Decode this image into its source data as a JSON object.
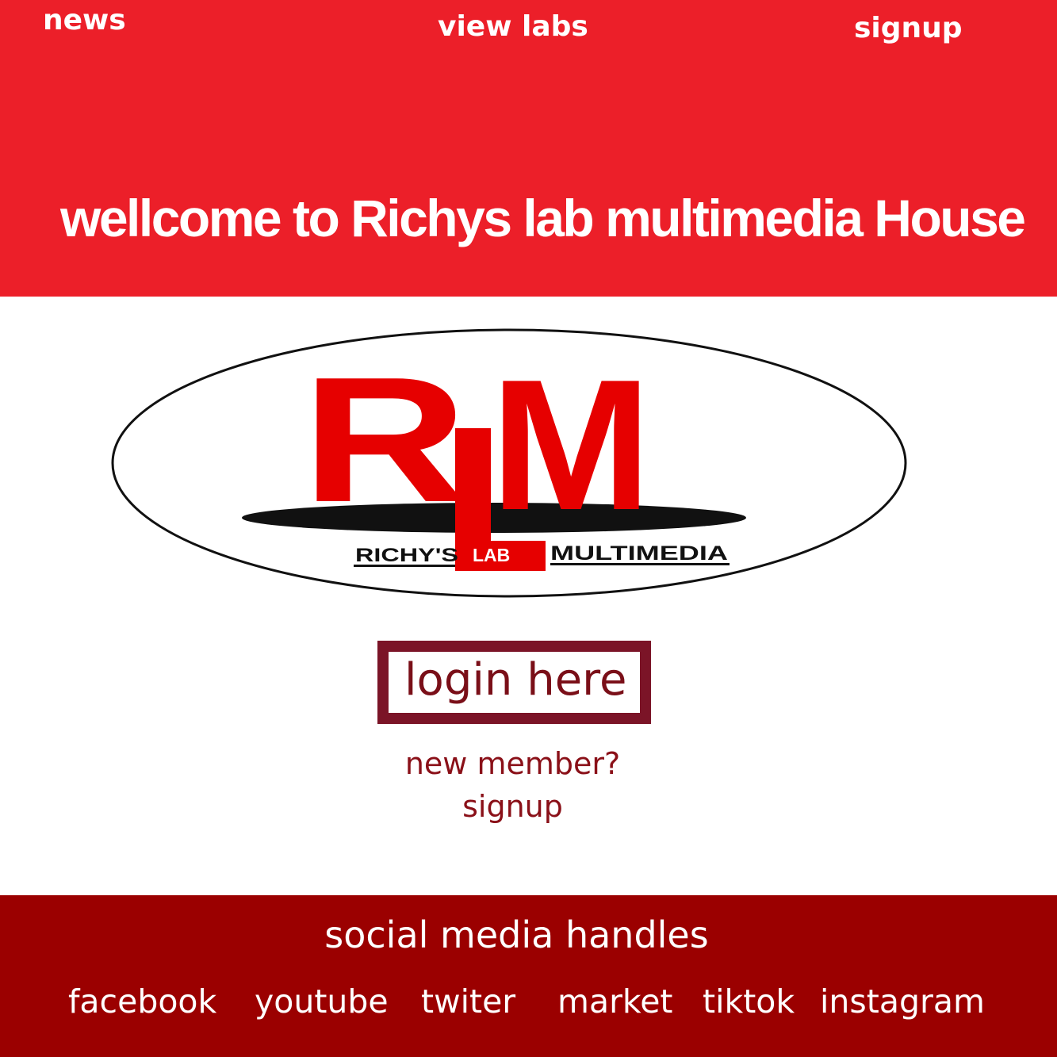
{
  "nav": {
    "news": "news",
    "view_labs": "view labs",
    "signup": "signup"
  },
  "header": {
    "welcome": "wellcome to Richys lab multimedia House",
    "background_color": "#ec1f29"
  },
  "logo": {
    "letters_r": "R",
    "letters_m": "M",
    "richys": "RICHY'S",
    "lab": "LAB",
    "multimedia": "MULTIMEDIA",
    "brand_color": "#e60000"
  },
  "login": {
    "label": "login here",
    "border_color": "#7b1427"
  },
  "signup_prompt": {
    "question": "new member?",
    "link": "signup"
  },
  "footer": {
    "title": "social media handles",
    "background_color": "#9b0000",
    "links": [
      "facebook",
      "youtube",
      "twiter",
      "market",
      "tiktok",
      "instagram"
    ]
  }
}
